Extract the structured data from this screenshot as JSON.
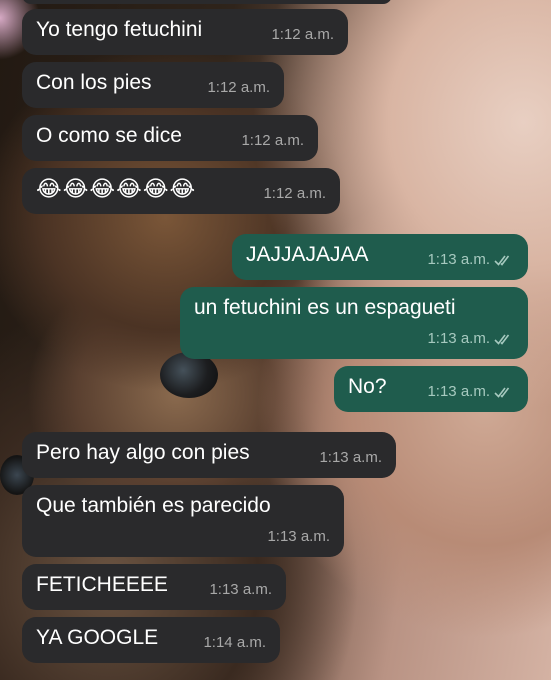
{
  "colors": {
    "incoming_bubble": "#2a2a2c",
    "outgoing_bubble": "#1f5c4d",
    "text": "#ffffff",
    "timestamp_in": "#a8a8a8",
    "timestamp_out": "#a6c9bf"
  },
  "messages": [
    {
      "direction": "in",
      "text": "Yo tengo fetuchini",
      "time": "1:12 a.m."
    },
    {
      "direction": "in",
      "text": "Con los pies",
      "time": "1:12 a.m."
    },
    {
      "direction": "in",
      "text": "O como se dice",
      "time": "1:12 a.m."
    },
    {
      "direction": "in",
      "text": "😂😂😂😂😂😂",
      "time": "1:12 a.m."
    },
    {
      "direction": "out",
      "text": "JAJJAJAJAA",
      "time": "1:13 a.m.",
      "status_icon": "double-check-icon"
    },
    {
      "direction": "out",
      "text": "un fetuchini es un espagueti",
      "time": "1:13 a.m.",
      "status_icon": "double-check-icon"
    },
    {
      "direction": "out",
      "text": "No?",
      "time": "1:13 a.m.",
      "status_icon": "double-check-icon"
    },
    {
      "direction": "in",
      "text": "Pero hay algo con pies",
      "time": "1:13 a.m."
    },
    {
      "direction": "in",
      "text": "Que también es parecido",
      "time": "1:13 a.m."
    },
    {
      "direction": "in",
      "text": "FETICHEEEE",
      "time": "1:13 a.m."
    },
    {
      "direction": "in",
      "text": "YA GOOGLE",
      "time": "1:14 a.m."
    }
  ]
}
